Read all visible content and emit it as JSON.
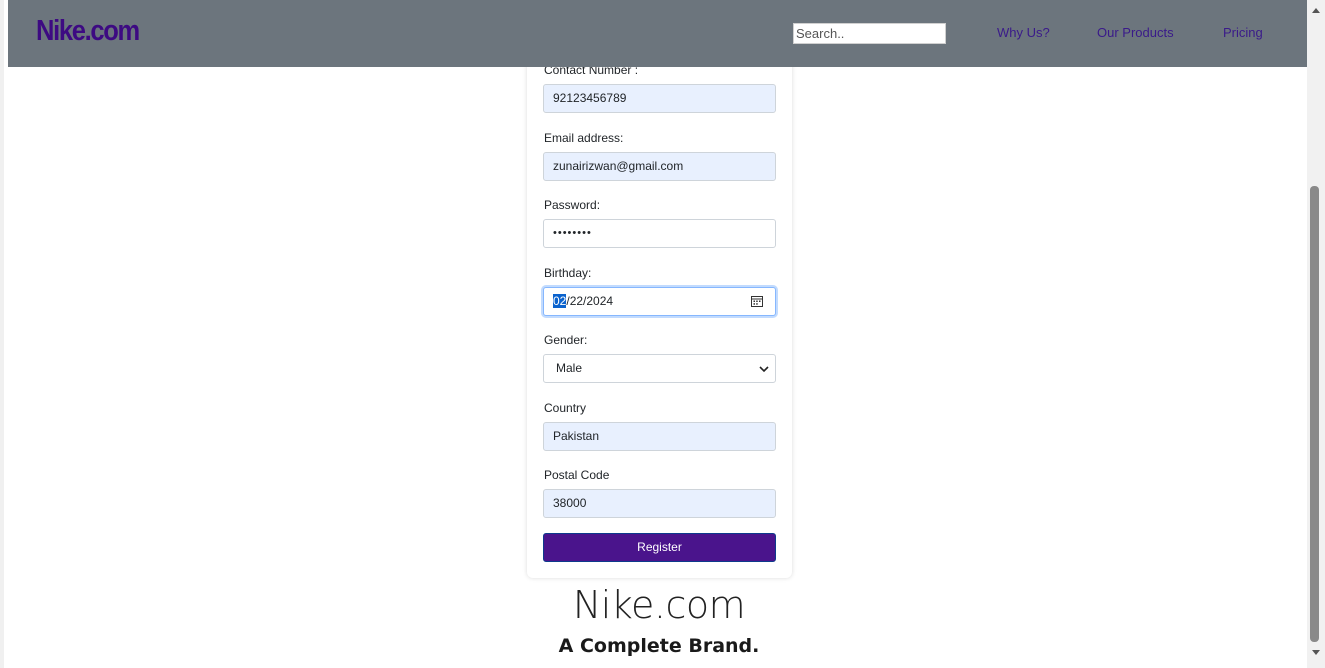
{
  "navbar": {
    "logo": "Nike.com",
    "search_placeholder": "Search..",
    "links": [
      "Why Us?",
      "Our Products",
      "Pricing"
    ]
  },
  "form": {
    "contact": {
      "label": "Contact Number :",
      "value": "92123456789"
    },
    "email": {
      "label": "Email address:",
      "value": "zunairizwan@gmail.com"
    },
    "password": {
      "label": "Password:",
      "value": "••••••••"
    },
    "birthday": {
      "label": "Birthday:",
      "month": "02",
      "rest": "/22/2024"
    },
    "gender": {
      "label": "Gender:",
      "value": "Male"
    },
    "country": {
      "label": "Country",
      "value": "Pakistan"
    },
    "postal": {
      "label": "Postal Code",
      "value": "38000"
    },
    "register_label": "Register"
  },
  "footer": {
    "brand": "Nike.com",
    "tagline": "A Complete Brand."
  },
  "colors": {
    "navbar_bg": "#6c757d",
    "brand_purple": "#4a148c",
    "autofill_bg": "#e8f0fe"
  }
}
